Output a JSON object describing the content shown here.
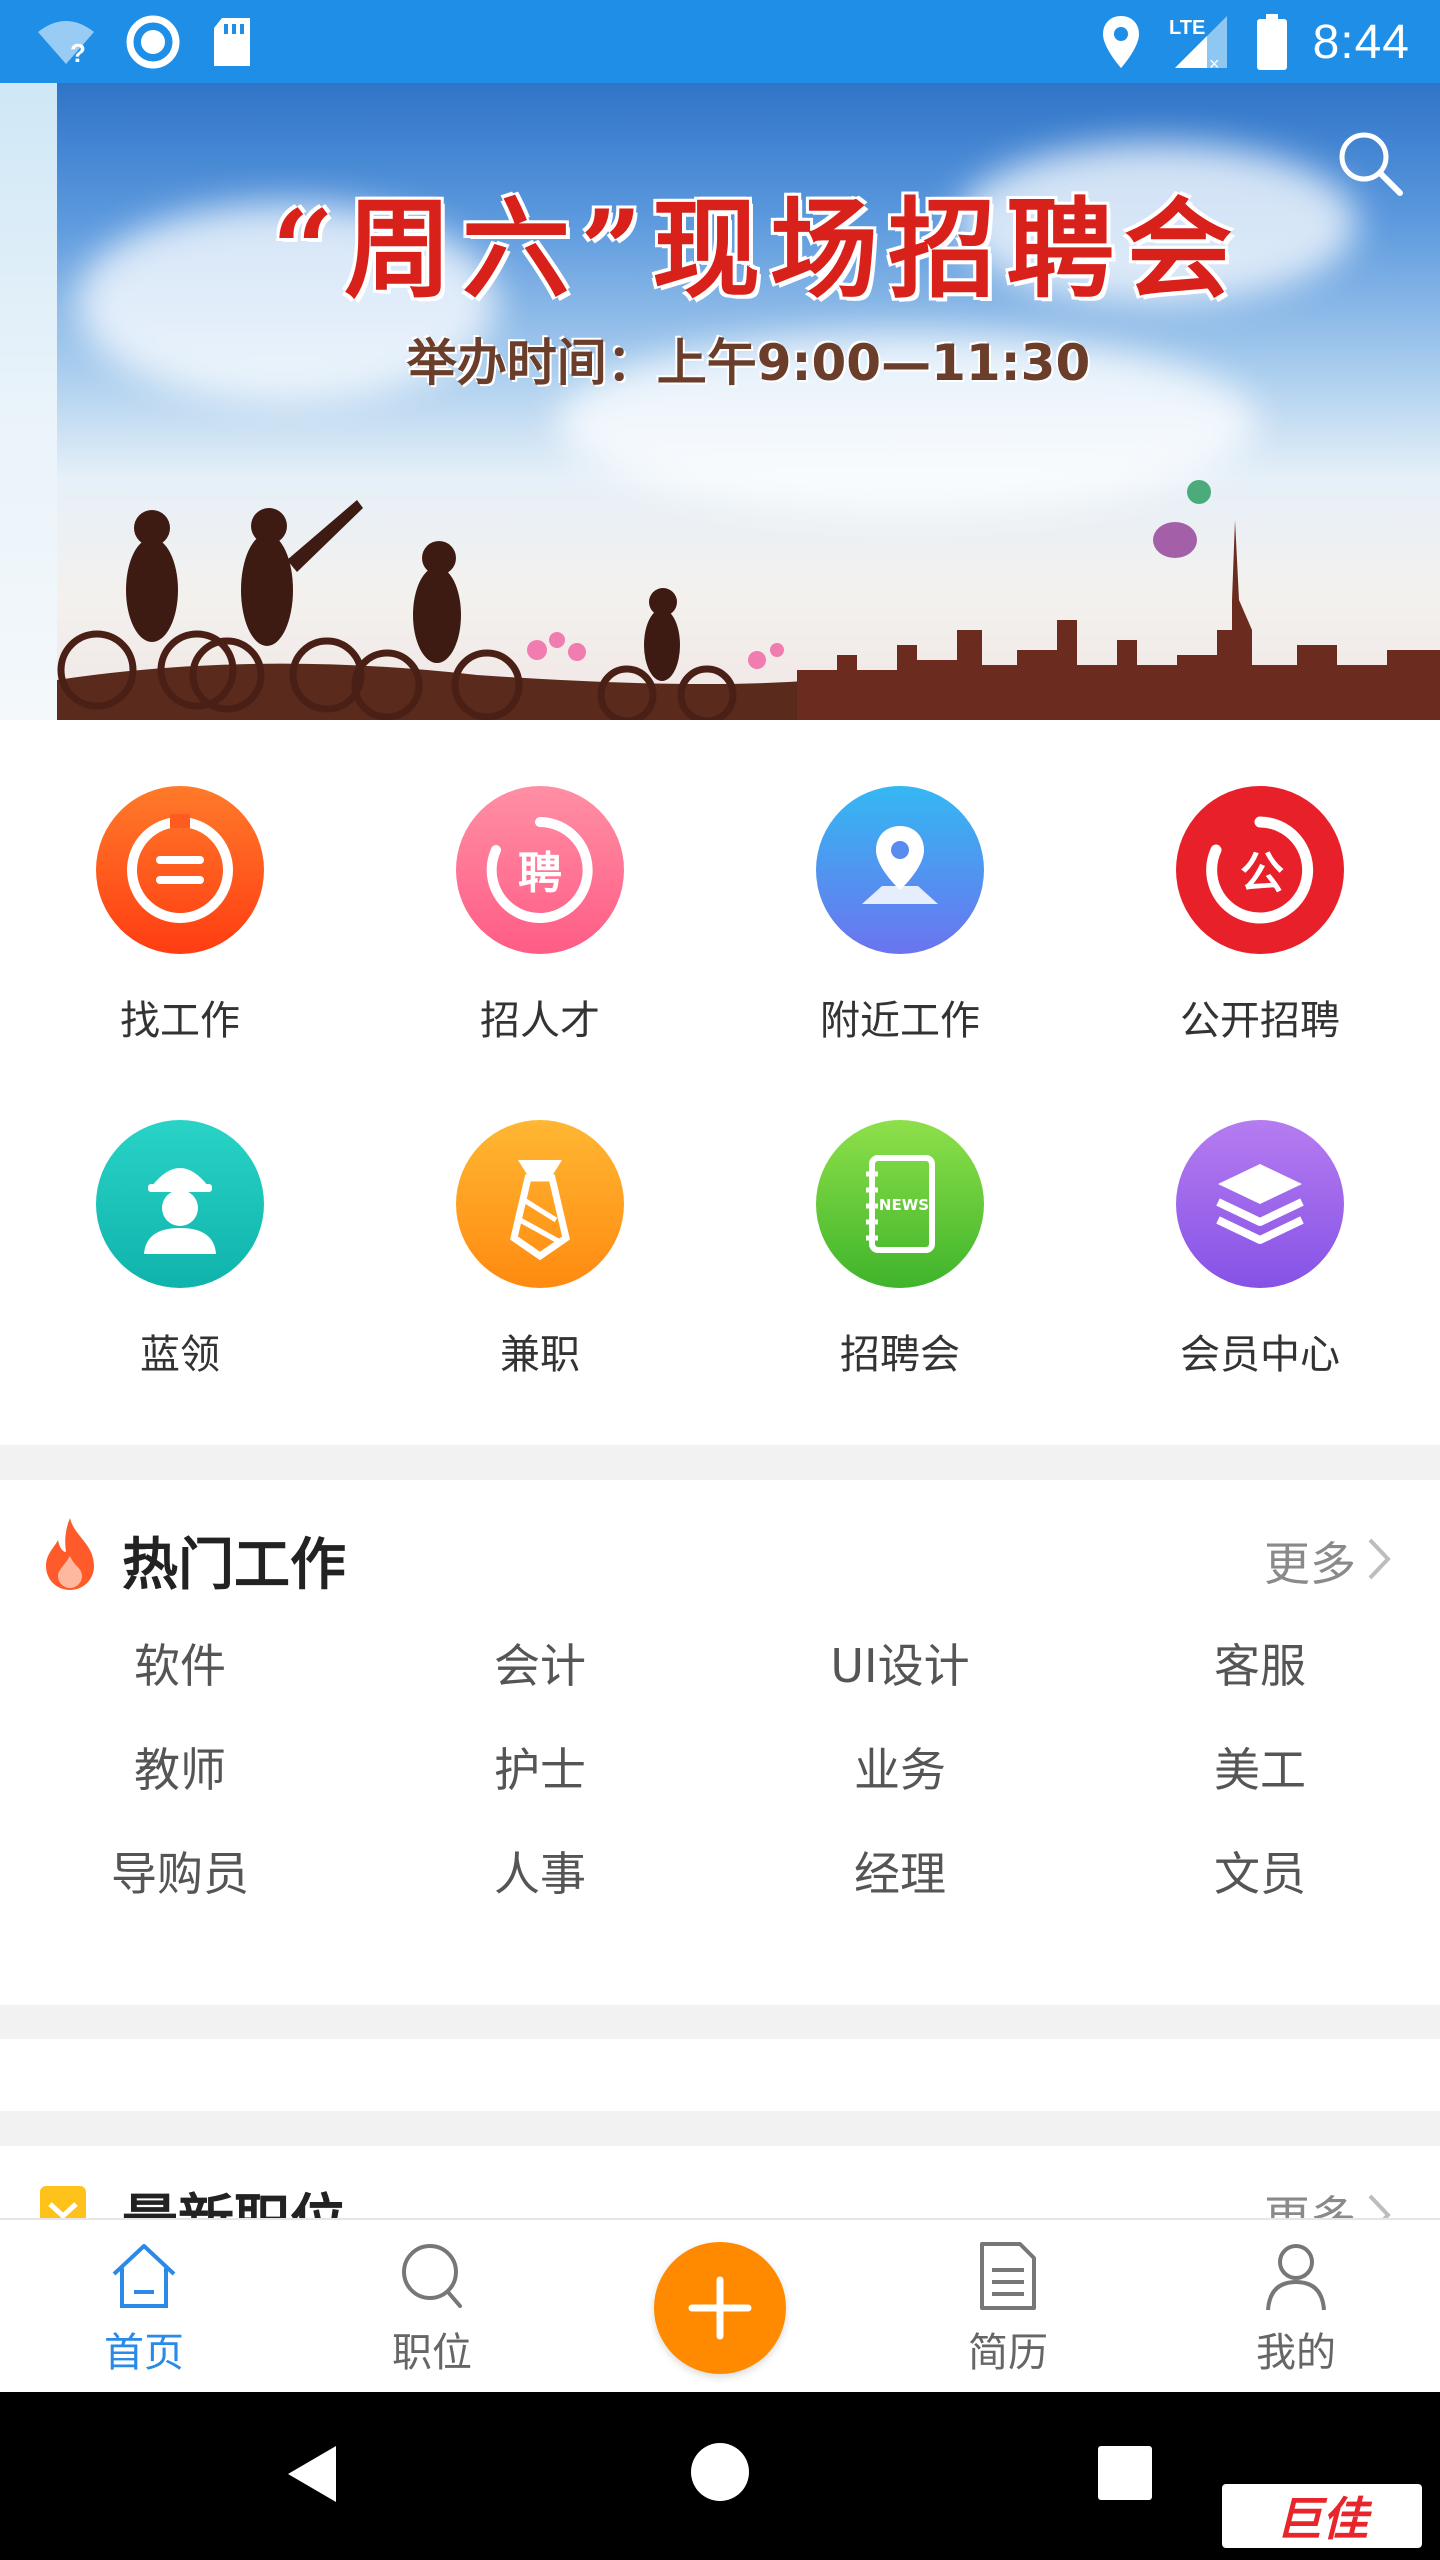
{
  "status_bar": {
    "time": "8:44",
    "network": "LTE",
    "icons": [
      "wifi-unknown-icon",
      "sync-icon",
      "sd-card-icon",
      "location-icon",
      "cell-signal-icon",
      "battery-icon"
    ]
  },
  "banner": {
    "title": "“周六”现场招聘会",
    "subtitle": "举办时间：上午9:00—11:30"
  },
  "categories": [
    {
      "label": "找工作",
      "icon": "list-icon",
      "color": "#ff5a1f"
    },
    {
      "label": "招人才",
      "icon": "recruit-icon",
      "color": "#ff6f8f"
    },
    {
      "label": "附近工作",
      "icon": "map-pin-icon",
      "color": "#4f86f0"
    },
    {
      "label": "公开招聘",
      "icon": "public-recruit-icon",
      "color": "#e8202a"
    },
    {
      "label": "蓝领",
      "icon": "worker-icon",
      "color": "#18c3b8"
    },
    {
      "label": "兼职",
      "icon": "tie-icon",
      "color": "#ff9f1a"
    },
    {
      "label": "招聘会",
      "icon": "news-notebook-icon",
      "color": "#5cc837"
    },
    {
      "label": "会员中心",
      "icon": "layers-icon",
      "color": "#9a63ea"
    }
  ],
  "hot_jobs": {
    "title": "热门工作",
    "more": "更多",
    "items": [
      "软件",
      "会计",
      "UI设计",
      "客服",
      "教师",
      "护士",
      "业务",
      "美工",
      "导购员",
      "人事",
      "经理",
      "文员"
    ]
  },
  "latest_jobs": {
    "title": "最新职位",
    "more": "更多"
  },
  "bottom_nav": {
    "items": [
      {
        "label": "首页",
        "icon": "home-icon",
        "active": true
      },
      {
        "label": "职位",
        "icon": "search-icon",
        "active": false
      },
      {
        "label": "",
        "icon": "plus-icon",
        "active": false
      },
      {
        "label": "简历",
        "icon": "resume-icon",
        "active": false
      },
      {
        "label": "我的",
        "icon": "user-icon",
        "active": false
      }
    ],
    "active_color": "#2a8ae6",
    "add_color": "#ff8a00"
  },
  "system_nav": {
    "watermark": "巨佳"
  }
}
